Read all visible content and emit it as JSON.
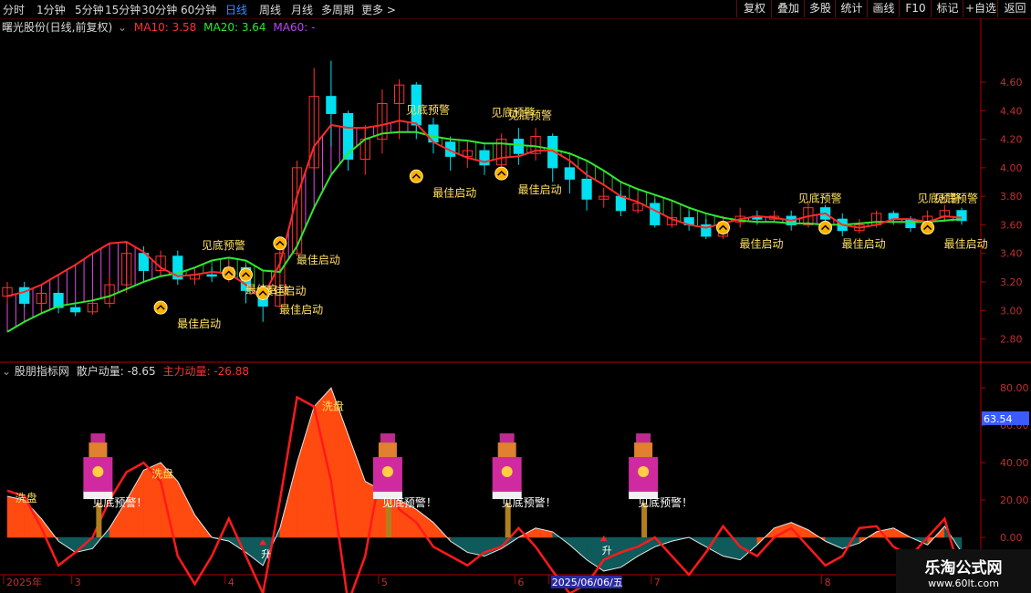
{
  "toolbar": {
    "timeframes": [
      "分时",
      "1分钟",
      "5分钟",
      "15分钟",
      "30分钟",
      "60分钟",
      "日线",
      "周线",
      "月线",
      "多周期",
      "更多 >"
    ],
    "active": "日线",
    "buttons": [
      "复权",
      "叠加",
      "多股",
      "统计",
      "画线",
      "F10",
      "标记",
      "+自选",
      "返回"
    ]
  },
  "main_header": {
    "stock": "曙光股份(日线,前复权)",
    "ma10_label": "MA10: 3.58",
    "ma20_label": "MA20: 3.64",
    "ma60_label": "MA60: -"
  },
  "sub_header": {
    "name": "股朋指标网",
    "retail_label": "散户动量: -8.65",
    "main_label": "主力动量: -26.88"
  },
  "colors": {
    "up": "#ff3232",
    "down": "#00e0f0",
    "ma10": "#ff2a2a",
    "ma20": "#30e830",
    "ma60": "#c040ff",
    "fill_up": "#ff50ff",
    "fill_down": "#30c830",
    "axis": "#b00000",
    "text_yellow": "#ffe060",
    "label_blue": "#3a5cff"
  },
  "chart_data": [
    {
      "type": "candlestick",
      "title": "曙光股份(日线,前复权)",
      "yticks": [
        2.8,
        3.0,
        3.2,
        3.4,
        3.6,
        3.8,
        4.0,
        4.2,
        4.4,
        4.6
      ],
      "ylim": [
        2.65,
        4.92
      ],
      "series": [
        {
          "name": "MA10",
          "values": [
            3.1,
            3.13,
            3.18,
            3.25,
            3.32,
            3.4,
            3.47,
            3.48,
            3.41,
            3.3,
            3.24,
            3.25,
            3.27,
            3.26,
            3.18,
            3.09,
            3.33,
            3.8,
            4.15,
            4.3,
            4.28,
            4.28,
            4.3,
            4.33,
            4.31,
            4.18,
            4.12,
            4.07,
            4.04,
            4.07,
            4.08,
            4.12,
            4.12,
            4.05,
            3.95,
            3.88,
            3.8,
            3.76,
            3.7,
            3.64,
            3.6,
            3.58,
            3.61,
            3.64,
            3.66,
            3.65,
            3.63,
            3.66,
            3.68,
            3.6,
            3.58,
            3.6,
            3.64,
            3.64,
            3.62,
            3.66,
            3.65
          ]
        },
        {
          "name": "MA20",
          "values": [
            2.85,
            2.92,
            2.98,
            3.03,
            3.05,
            3.07,
            3.1,
            3.15,
            3.2,
            3.24,
            3.26,
            3.3,
            3.35,
            3.37,
            3.35,
            3.28,
            3.27,
            3.45,
            3.72,
            3.95,
            4.1,
            4.2,
            4.24,
            4.25,
            4.25,
            4.22,
            4.2,
            4.19,
            4.17,
            4.17,
            4.16,
            4.15,
            4.13,
            4.1,
            4.05,
            3.98,
            3.9,
            3.85,
            3.81,
            3.77,
            3.72,
            3.68,
            3.65,
            3.63,
            3.62,
            3.62,
            3.61,
            3.61,
            3.6,
            3.6,
            3.61,
            3.62,
            3.62,
            3.62,
            3.62,
            3.63,
            3.64
          ]
        },
        {
          "name": "MA60",
          "values": []
        }
      ],
      "candles": [
        [
          3.1,
          3.16,
          3.05,
          3.2
        ],
        [
          3.16,
          3.05,
          3.02,
          3.2
        ],
        [
          3.05,
          3.12,
          3.0,
          3.15
        ],
        [
          3.12,
          3.02,
          2.98,
          3.14
        ],
        [
          3.02,
          2.99,
          2.96,
          3.05
        ],
        [
          2.99,
          3.05,
          2.97,
          3.08
        ],
        [
          3.05,
          3.18,
          3.02,
          3.25
        ],
        [
          3.18,
          3.4,
          3.12,
          3.48
        ],
        [
          3.4,
          3.28,
          3.2,
          3.45
        ],
        [
          3.28,
          3.38,
          3.24,
          3.42
        ],
        [
          3.38,
          3.22,
          3.18,
          3.42
        ],
        [
          3.22,
          3.25,
          3.18,
          3.3
        ],
        [
          3.25,
          3.24,
          3.2,
          3.3
        ],
        [
          3.24,
          3.3,
          3.2,
          3.34
        ],
        [
          3.3,
          3.14,
          3.05,
          3.32
        ],
        [
          3.14,
          3.03,
          2.92,
          3.15
        ],
        [
          3.03,
          3.4,
          3.02,
          3.42
        ],
        [
          3.4,
          4.0,
          3.38,
          4.05
        ],
        [
          4.0,
          4.5,
          3.98,
          4.7
        ],
        [
          4.5,
          4.38,
          4.15,
          4.75
        ],
        [
          4.38,
          4.06,
          3.98,
          4.4
        ],
        [
          4.06,
          4.2,
          3.95,
          4.3
        ],
        [
          4.2,
          4.45,
          4.1,
          4.55
        ],
        [
          4.45,
          4.58,
          4.2,
          4.62
        ],
        [
          4.58,
          4.3,
          4.2,
          4.6
        ],
        [
          4.3,
          4.18,
          4.1,
          4.35
        ],
        [
          4.18,
          4.08,
          3.98,
          4.22
        ],
        [
          4.08,
          4.12,
          4.0,
          4.18
        ],
        [
          4.12,
          4.02,
          3.95,
          4.15
        ],
        [
          4.02,
          4.2,
          4.0,
          4.24
        ],
        [
          4.2,
          4.1,
          4.02,
          4.28
        ],
        [
          4.1,
          4.22,
          4.05,
          4.28
        ],
        [
          4.22,
          4.0,
          3.9,
          4.24
        ],
        [
          4.0,
          3.92,
          3.82,
          4.05
        ],
        [
          3.92,
          3.78,
          3.7,
          3.98
        ],
        [
          3.78,
          3.8,
          3.72,
          3.86
        ],
        [
          3.8,
          3.7,
          3.66,
          3.84
        ],
        [
          3.7,
          3.75,
          3.68,
          3.82
        ],
        [
          3.75,
          3.6,
          3.58,
          3.78
        ],
        [
          3.6,
          3.65,
          3.58,
          3.68
        ],
        [
          3.65,
          3.6,
          3.56,
          3.7
        ],
        [
          3.6,
          3.52,
          3.5,
          3.64
        ],
        [
          3.52,
          3.62,
          3.5,
          3.66
        ],
        [
          3.62,
          3.66,
          3.58,
          3.72
        ],
        [
          3.66,
          3.64,
          3.6,
          3.7
        ],
        [
          3.64,
          3.66,
          3.62,
          3.7
        ],
        [
          3.66,
          3.6,
          3.56,
          3.7
        ],
        [
          3.6,
          3.72,
          3.58,
          3.76
        ],
        [
          3.72,
          3.64,
          3.6,
          3.74
        ],
        [
          3.64,
          3.56,
          3.52,
          3.68
        ],
        [
          3.56,
          3.6,
          3.54,
          3.64
        ],
        [
          3.6,
          3.68,
          3.58,
          3.7
        ],
        [
          3.68,
          3.64,
          3.6,
          3.7
        ],
        [
          3.64,
          3.58,
          3.55,
          3.66
        ],
        [
          3.58,
          3.66,
          3.56,
          3.7
        ],
        [
          3.66,
          3.7,
          3.62,
          3.74
        ],
        [
          3.7,
          3.63,
          3.6,
          3.72
        ]
      ],
      "annotations": [
        {
          "i": 9,
          "price": 3.02,
          "kind": "start"
        },
        {
          "i": 13,
          "price": 3.26,
          "kind": "start"
        },
        {
          "i": 13,
          "price": 3.43,
          "kind": "warn"
        },
        {
          "i": 14,
          "price": 3.25,
          "kind": "start"
        },
        {
          "i": 15,
          "price": 3.12,
          "kind": "start"
        },
        {
          "i": 16,
          "price": 3.47,
          "kind": "start"
        },
        {
          "i": 24,
          "price": 3.94,
          "kind": "start"
        },
        {
          "i": 25,
          "price": 4.38,
          "kind": "warn"
        },
        {
          "i": 29,
          "price": 3.96,
          "kind": "start"
        },
        {
          "i": 30,
          "price": 4.36,
          "kind": "warn"
        },
        {
          "i": 31,
          "price": 4.34,
          "kind": "warn"
        },
        {
          "i": 42,
          "price": 3.58,
          "kind": "start"
        },
        {
          "i": 48,
          "price": 3.58,
          "kind": "start"
        },
        {
          "i": 48,
          "price": 3.76,
          "kind": "warn"
        },
        {
          "i": 54,
          "price": 3.58,
          "kind": "start"
        },
        {
          "i": 55,
          "price": 3.76,
          "kind": "warn"
        },
        {
          "i": 56,
          "price": 3.76,
          "kind": "warn"
        }
      ],
      "text_labels": {
        "warn": "见底预警",
        "start": "最佳启动"
      }
    },
    {
      "type": "area",
      "title": "股朋指标网",
      "yticks": [
        0,
        20,
        40,
        60,
        80
      ],
      "ylim": [
        -20,
        85
      ],
      "cursor_value": "63.54",
      "series": [
        {
          "name": "散户动量",
          "values": [
            22,
            20,
            10,
            -2,
            -8,
            -6,
            5,
            20,
            36,
            40,
            30,
            12,
            0,
            -2,
            -8,
            -15,
            5,
            40,
            70,
            80,
            55,
            30,
            25,
            20,
            15,
            8,
            -2,
            -8,
            -10,
            -6,
            0,
            5,
            3,
            -4,
            -12,
            -18,
            -16,
            -10,
            -5,
            -2,
            0,
            -5,
            -10,
            -12,
            -4,
            5,
            8,
            4,
            -2,
            -6,
            -3,
            3,
            5,
            0,
            -4,
            6,
            -8
          ]
        },
        {
          "name": "主力动量",
          "values": [
            25,
            22,
            5,
            -15,
            -8,
            0,
            20,
            35,
            40,
            30,
            -10,
            -25,
            -10,
            10,
            -10,
            -30,
            20,
            75,
            70,
            30,
            -35,
            -10,
            40,
            15,
            8,
            -5,
            -10,
            -15,
            -8,
            -5,
            5,
            -5,
            -18,
            -30,
            -25,
            -12,
            -8,
            -5,
            0,
            -10,
            -20,
            -8,
            6,
            -5,
            -10,
            0,
            5,
            -5,
            -15,
            -10,
            5,
            6,
            -5,
            -10,
            0,
            10,
            -22
          ]
        }
      ],
      "markers_up": [
        {
          "i": 15,
          "v": -4
        },
        {
          "i": 35,
          "v": -2
        }
      ],
      "shakeout": [
        {
          "i": 1,
          "v": 22
        },
        {
          "i": 9,
          "v": 35
        },
        {
          "i": 19,
          "v": 71
        }
      ],
      "text_labels": {
        "shakeout": "洗盘",
        "rise": "升",
        "warn": "见底预警！"
      },
      "figures": [
        {
          "i": 5,
          "label": "见底预警！"
        },
        {
          "i": 22,
          "label": "见底预警！"
        },
        {
          "i": 29,
          "label": "见底预警！"
        },
        {
          "i": 37,
          "label": "见底预警！"
        }
      ]
    }
  ],
  "x_axis": {
    "labels": [
      {
        "i": 0,
        "text": "2025年"
      },
      {
        "i": 4,
        "text": "3"
      },
      {
        "i": 13,
        "text": "4"
      },
      {
        "i": 22,
        "text": "5"
      },
      {
        "i": 30,
        "text": "6"
      },
      {
        "i": 32,
        "text": "2025/06/06/五"
      },
      {
        "i": 38,
        "text": "7"
      },
      {
        "i": 48,
        "text": "8"
      }
    ]
  },
  "watermark": {
    "line1": "乐淘公式网",
    "line2": "www.60lt.com"
  }
}
